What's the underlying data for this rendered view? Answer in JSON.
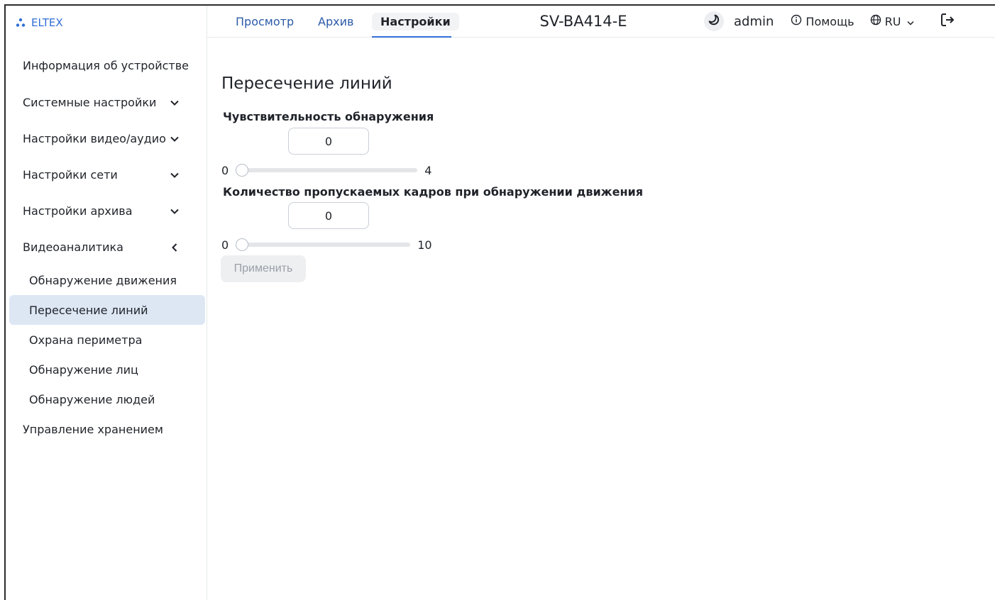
{
  "brand": {
    "name": "ELTEX",
    "color": "#2f6fd6"
  },
  "header": {
    "tabs": [
      {
        "label": "Просмотр",
        "active": false
      },
      {
        "label": "Архив",
        "active": false
      },
      {
        "label": "Настройки",
        "active": true
      }
    ],
    "device_model": "SV-BA414-E",
    "username": "admin",
    "help_label": "Помощь",
    "language": "RU"
  },
  "sidebar": {
    "items": [
      {
        "label": "Информация об устройстве",
        "icon": ""
      },
      {
        "label": "Системные настройки",
        "icon": "chevron-down-icon"
      },
      {
        "label": "Настройки видео/аудио",
        "icon": "chevron-down-icon"
      },
      {
        "label": "Настройки сети",
        "icon": "chevron-down-icon"
      },
      {
        "label": "Настройки архива",
        "icon": "chevron-down-icon"
      },
      {
        "label": "Видеоаналитика",
        "icon": "chevron-left-icon"
      }
    ],
    "subitems": [
      {
        "label": "Обнаружение движения",
        "active": false
      },
      {
        "label": "Пересечение линий",
        "active": true
      },
      {
        "label": "Охрана периметра",
        "active": false
      },
      {
        "label": "Обнаружение лиц",
        "active": false
      },
      {
        "label": "Обнаружение людей",
        "active": false
      }
    ],
    "last_item": {
      "label": "Управление хранением"
    }
  },
  "main": {
    "title": "Пересечение линий",
    "sensitivity": {
      "label": "Чувствительность обнаружения",
      "value": "0",
      "min": "0",
      "max": "4",
      "level": 0
    },
    "skip_frames": {
      "label": "Количество пропускаемых кадров при обнаружении движения",
      "value": "0",
      "min": "0",
      "max": "10",
      "level": 0
    },
    "apply_label": "Применить"
  }
}
